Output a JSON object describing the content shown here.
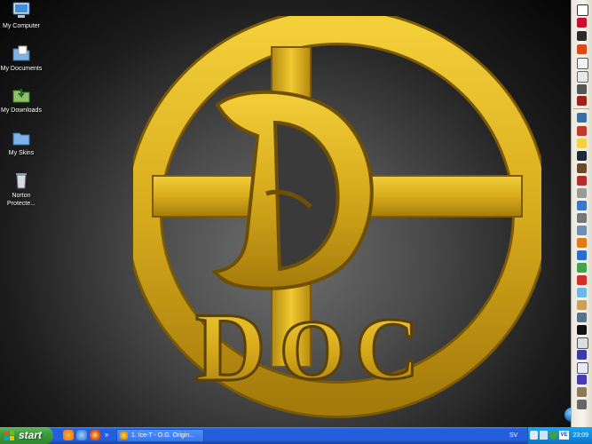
{
  "desktop": {
    "icons": [
      {
        "label": "My Computer",
        "icon": "my-computer-icon"
      },
      {
        "label": "My Documents",
        "icon": "my-documents-icon"
      },
      {
        "label": "My Downloads",
        "icon": "my-downloads-icon"
      },
      {
        "label": "My Skins",
        "icon": "my-skins-icon"
      },
      {
        "label": "Norton Protecte...",
        "icon": "norton-recycle-bin-icon"
      }
    ],
    "logo": {
      "letters": [
        "D",
        "O",
        "C"
      ],
      "big_letter": "D",
      "color": "#d8ab1c"
    }
  },
  "taskbar": {
    "start_label": "start",
    "quick_launch": [
      "media-player-icon",
      "internet-explorer-icon",
      "firefox-icon"
    ],
    "overflow_label": "»",
    "task": {
      "label": "1. Ice-T - O.G. Origin...",
      "icon": "winamp-icon"
    },
    "tray": {
      "language": "SV",
      "clock": "23:09",
      "badge": "VE"
    }
  },
  "colors": {
    "accent_gold": "#d8ab1c",
    "taskbar_blue": "#245edb",
    "start_green": "#3c9a3c"
  }
}
